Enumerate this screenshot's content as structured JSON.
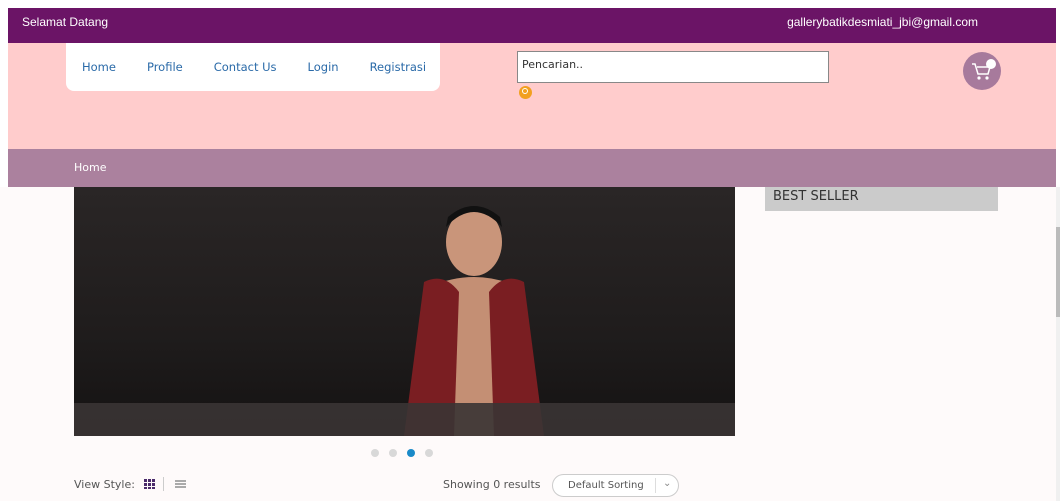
{
  "topbar": {
    "welcome": "Selamat Datang",
    "email": "gallerybatikdesmiati_jbi@gmail.com"
  },
  "nav": {
    "items": [
      "Home",
      "Profile",
      "Contact Us",
      "Login",
      "Registrasi"
    ]
  },
  "search": {
    "placeholder": "Pencarian..",
    "icon": "search-icon"
  },
  "cart": {
    "icon": "cart-icon"
  },
  "breadcrumb": {
    "current": "Home"
  },
  "slider": {
    "dots_count": 4,
    "active_index": 2
  },
  "sidebar": {
    "bestseller_title": "BEST SELLER"
  },
  "toolbar": {
    "view_style_label": "View Style:",
    "results_text": "Showing 0 results",
    "sorting_selected": "Default Sorting"
  },
  "colors": {
    "topbar": "#6b1466",
    "header": "#ffcccc",
    "breadcrumb": "#ab819e",
    "cart": "#a77a9c",
    "active_dot": "#1a8ac8"
  }
}
